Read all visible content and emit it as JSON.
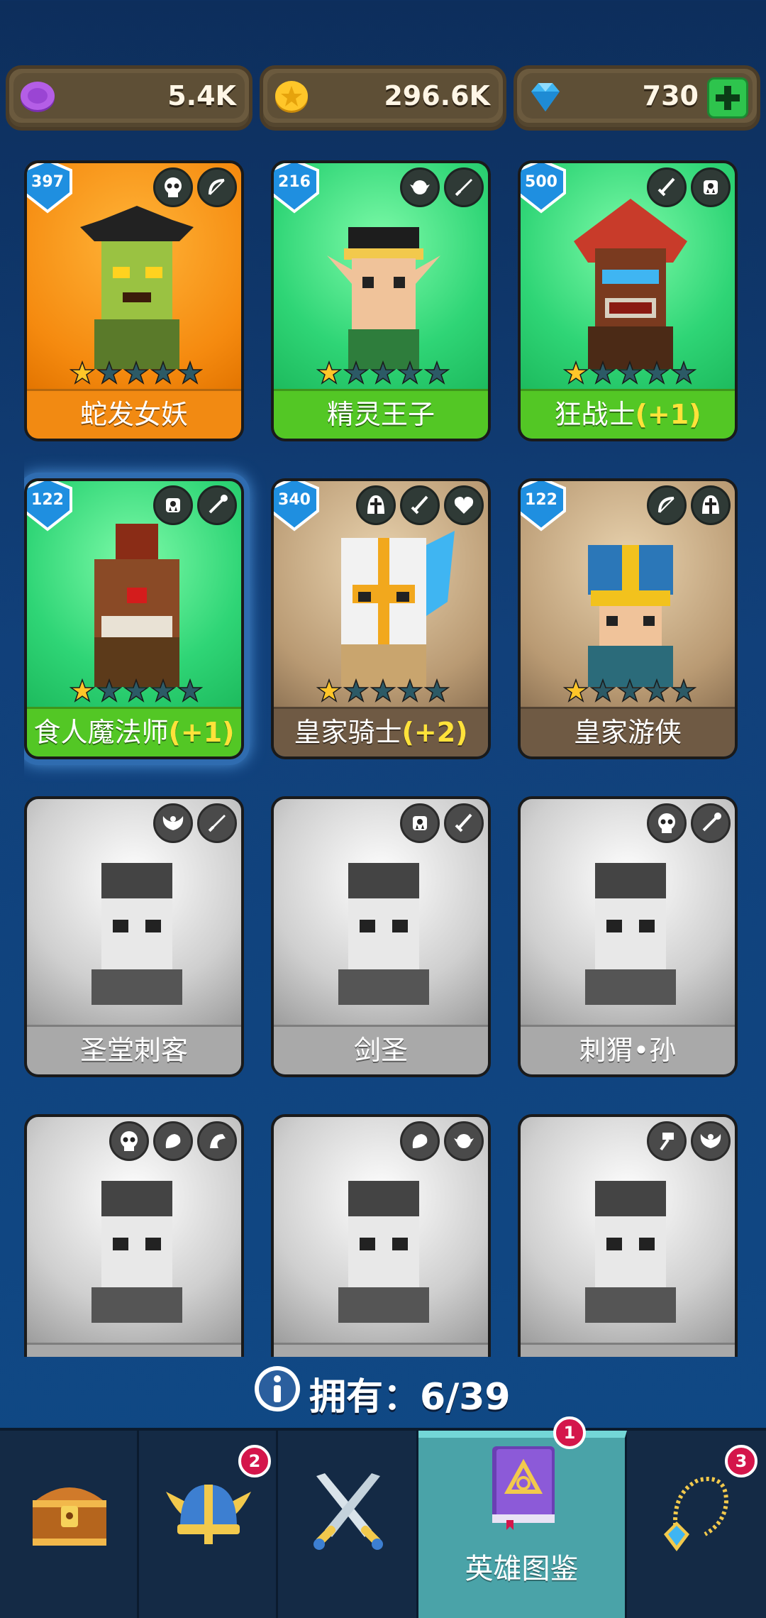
{
  "currency": {
    "gems": "5.4K",
    "gold": "296.6K",
    "diamonds": "730",
    "add_label": "+"
  },
  "heroes": [
    {
      "name": "蛇发女妖",
      "level": "397",
      "plus": "",
      "stars": 1,
      "rarity": "orange",
      "badges": [
        "skull-icon",
        "bow-icon"
      ]
    },
    {
      "name": "精灵王子",
      "level": "216",
      "plus": "",
      "stars": 1,
      "rarity": "green",
      "badges": [
        "elf-icon",
        "dagger-icon"
      ]
    },
    {
      "name": "狂战士",
      "level": "500",
      "plus": "(+1)",
      "stars": 1,
      "rarity": "green",
      "badges": [
        "sword-icon",
        "orc-icon"
      ]
    },
    {
      "name": "食人魔法师",
      "level": "122",
      "plus": "(+1)",
      "stars": 1,
      "rarity": "green",
      "badges": [
        "orc-icon",
        "staff-icon"
      ]
    },
    {
      "name": "皇家骑士",
      "level": "340",
      "plus": "(+2)",
      "stars": 1,
      "rarity": "brown",
      "badges": [
        "helmet-icon",
        "sword-icon",
        "heart-icon"
      ]
    },
    {
      "name": "皇家游侠",
      "level": "122",
      "plus": "",
      "stars": 1,
      "rarity": "brown",
      "badges": [
        "bow-icon",
        "helmet-icon"
      ]
    },
    {
      "name": "圣堂刺客",
      "level": "",
      "plus": "",
      "stars": 0,
      "rarity": "gray",
      "badges": [
        "wings-icon",
        "dagger-icon"
      ]
    },
    {
      "name": "剑圣",
      "level": "",
      "plus": "",
      "stars": 0,
      "rarity": "gray",
      "badges": [
        "orc-icon",
        "sword-icon"
      ]
    },
    {
      "name": "刺猬•孙",
      "level": "",
      "plus": "",
      "stars": 0,
      "rarity": "gray",
      "badges": [
        "skull-icon",
        "staff-icon"
      ]
    },
    {
      "name": "",
      "level": "",
      "plus": "",
      "stars": 0,
      "rarity": "gray",
      "badges": [
        "skull-icon",
        "beast-icon",
        "dragon-icon"
      ]
    },
    {
      "name": "",
      "level": "",
      "plus": "",
      "stars": 0,
      "rarity": "gray",
      "badges": [
        "beast-icon",
        "elf-icon"
      ]
    },
    {
      "name": "",
      "level": "",
      "plus": "",
      "stars": 0,
      "rarity": "gray",
      "badges": [
        "hammer-icon",
        "wings-icon"
      ]
    }
  ],
  "owned": {
    "label": "拥有：",
    "value": "6/39"
  },
  "nav": {
    "items": [
      {
        "name": "chest",
        "badge": ""
      },
      {
        "name": "heroes",
        "badge": "2"
      },
      {
        "name": "battle",
        "badge": ""
      },
      {
        "name": "codex",
        "label": "英雄图鉴",
        "badge": "1"
      },
      {
        "name": "equipment",
        "badge": "3"
      }
    ]
  },
  "colors": {
    "background": "#11407a",
    "active_tab": "#4aa3a8",
    "notification": "#d4164b",
    "plus_text": "#ffe23a"
  }
}
